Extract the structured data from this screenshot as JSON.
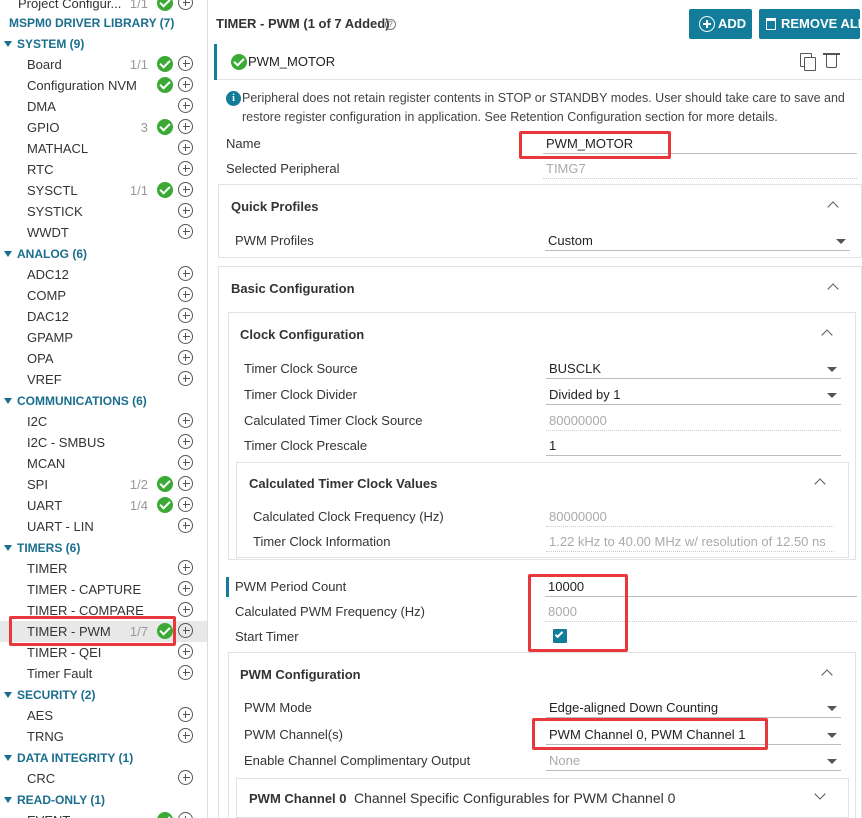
{
  "sidebar": {
    "top_item": "Project Configur...",
    "top_count": "1/1",
    "library": "MSPM0 DRIVER LIBRARY (7)",
    "groups": {
      "system": {
        "label": "SYSTEM (9)",
        "items": [
          {
            "name": "Board",
            "count": "1/1",
            "added": true
          },
          {
            "name": "Configuration NVM",
            "count": "",
            "added": false
          },
          {
            "name": "DMA",
            "count": "",
            "added": false
          },
          {
            "name": "GPIO",
            "count": "3",
            "added": true
          },
          {
            "name": "MATHACL",
            "count": "",
            "added": false
          },
          {
            "name": "RTC",
            "count": "",
            "added": false
          },
          {
            "name": "SYSCTL",
            "count": "1/1",
            "added": true
          },
          {
            "name": "SYSTICK",
            "count": "",
            "added": false
          },
          {
            "name": "WWDT",
            "count": "",
            "added": false
          }
        ]
      },
      "analog": {
        "label": "ANALOG (6)",
        "items": [
          {
            "name": "ADC12"
          },
          {
            "name": "COMP"
          },
          {
            "name": "DAC12"
          },
          {
            "name": "GPAMP"
          },
          {
            "name": "OPA"
          },
          {
            "name": "VREF"
          }
        ]
      },
      "communications": {
        "label": "COMMUNICATIONS (6)",
        "items": [
          {
            "name": "I2C",
            "count": ""
          },
          {
            "name": "I2C - SMBUS",
            "count": ""
          },
          {
            "name": "MCAN",
            "count": ""
          },
          {
            "name": "SPI",
            "count": "1/2"
          },
          {
            "name": "UART",
            "count": "1/4"
          },
          {
            "name": "UART - LIN",
            "count": ""
          }
        ]
      },
      "timers": {
        "label": "TIMERS (6)",
        "items": [
          {
            "name": "TIMER",
            "count": ""
          },
          {
            "name": "TIMER - CAPTURE",
            "count": ""
          },
          {
            "name": "TIMER - COMPARE",
            "count": ""
          },
          {
            "name": "TIMER - PWM",
            "count": "1/7"
          },
          {
            "name": "TIMER - QEI",
            "count": ""
          },
          {
            "name": "Timer Fault",
            "count": ""
          }
        ]
      },
      "security": {
        "label": "SECURITY (2)",
        "items": [
          {
            "name": "AES"
          },
          {
            "name": "TRNG"
          }
        ]
      },
      "data_integrity": {
        "label": "DATA INTEGRITY (1)",
        "items": [
          {
            "name": "CRC"
          }
        ]
      },
      "read_only": {
        "label": "READ-ONLY (1)",
        "items": [
          {
            "name": "EVENT"
          }
        ]
      }
    }
  },
  "header": {
    "title": "TIMER - PWM (1 of 7 Added)",
    "add_label": "ADD",
    "remove_all_label": "REMOVE ALL"
  },
  "instance": {
    "name": "PWM_MOTOR",
    "info": "Peripheral does not retain register contents in STOP or STANDBY modes. User should take care to save and restore register configuration in application. See Retention Configuration section for more details.",
    "name_label": "Name",
    "name_value": "PWM_MOTOR",
    "peripheral_label": "Selected Peripheral",
    "peripheral_value": "TIMG7"
  },
  "quick_profiles": {
    "title": "Quick Profiles",
    "profile_label": "PWM Profiles",
    "profile_value": "Custom"
  },
  "basic": {
    "title": "Basic Configuration",
    "clock": {
      "title": "Clock Configuration",
      "source_label": "Timer Clock Source",
      "source_value": "BUSCLK",
      "divider_label": "Timer Clock Divider",
      "divider_value": "Divided by 1",
      "calc_source_label": "Calculated Timer Clock Source",
      "calc_source_value": "80000000",
      "prescale_label": "Timer Clock Prescale",
      "prescale_value": "1",
      "calc_values": {
        "title": "Calculated Timer Clock Values",
        "freq_label": "Calculated Clock Frequency (Hz)",
        "freq_value": "80000000",
        "info_label": "Timer Clock Information",
        "info_value": "1.22 kHz to 40.00 MHz w/ resolution of 12.50 ns"
      }
    },
    "period_label": "PWM Period Count",
    "period_value": "10000",
    "pwm_freq_label": "Calculated PWM Frequency (Hz)",
    "pwm_freq_value": "8000",
    "start_label": "Start Timer",
    "start_checked": true
  },
  "pwm_config": {
    "title": "PWM Configuration",
    "mode_label": "PWM Mode",
    "mode_value": "Edge-aligned Down Counting",
    "channels_label": "PWM Channel(s)",
    "channels_value": "PWM Channel 0, PWM Channel 1",
    "comp_label": "Enable Channel Complimentary Output",
    "comp_value": "None",
    "channel0_title": "PWM Channel 0",
    "channel0_desc": "Channel Specific Configurables for PWM Channel 0"
  },
  "colors": {
    "accent": "#137c9a",
    "check": "#3aaa35",
    "highlight": "#e8383d",
    "category": "#1a6e8e"
  }
}
